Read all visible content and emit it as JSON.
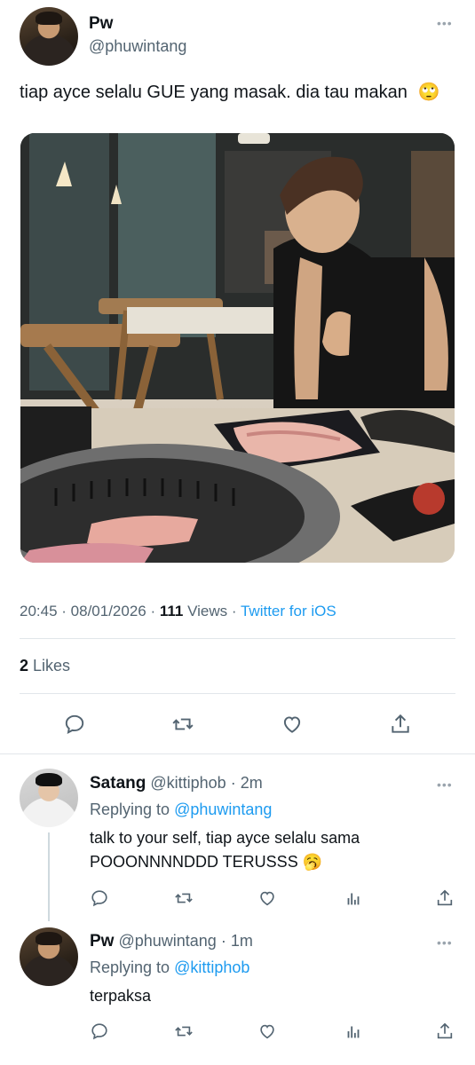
{
  "tweet": {
    "name": "Pw",
    "handle": "@phuwintang",
    "text": "tiap ayce selalu GUE yang masak. dia tau makan",
    "emoji": "🙄",
    "time": "20:45",
    "date": "08/01/2026",
    "views_count": "111",
    "views_label": "Views",
    "source": "Twitter for iOS",
    "likes_count": "2",
    "likes_label": "Likes"
  },
  "replies": [
    {
      "name": "Satang",
      "handle": "@kittiphob",
      "time": "2m",
      "replying_label": "Replying to",
      "replying_to": "@phuwintang",
      "text_line1": "talk to your self, tiap ayce selalu sama",
      "text_line2": "POOONNNNDDD TERUSSS",
      "emoji": "🥱"
    },
    {
      "name": "Pw",
      "handle": "@phuwintang",
      "time": "1m",
      "replying_label": "Replying to",
      "replying_to": "@kittiphob",
      "text": "terpaksa"
    }
  ],
  "icons": {
    "more": "more-icon",
    "reply": "reply-icon",
    "retweet": "retweet-icon",
    "like": "heart-icon",
    "share": "share-icon",
    "analytics": "analytics-icon"
  },
  "colors": {
    "accent": "#1d9bf0",
    "secondary_text": "#536471",
    "divider": "#e1e6ea"
  }
}
